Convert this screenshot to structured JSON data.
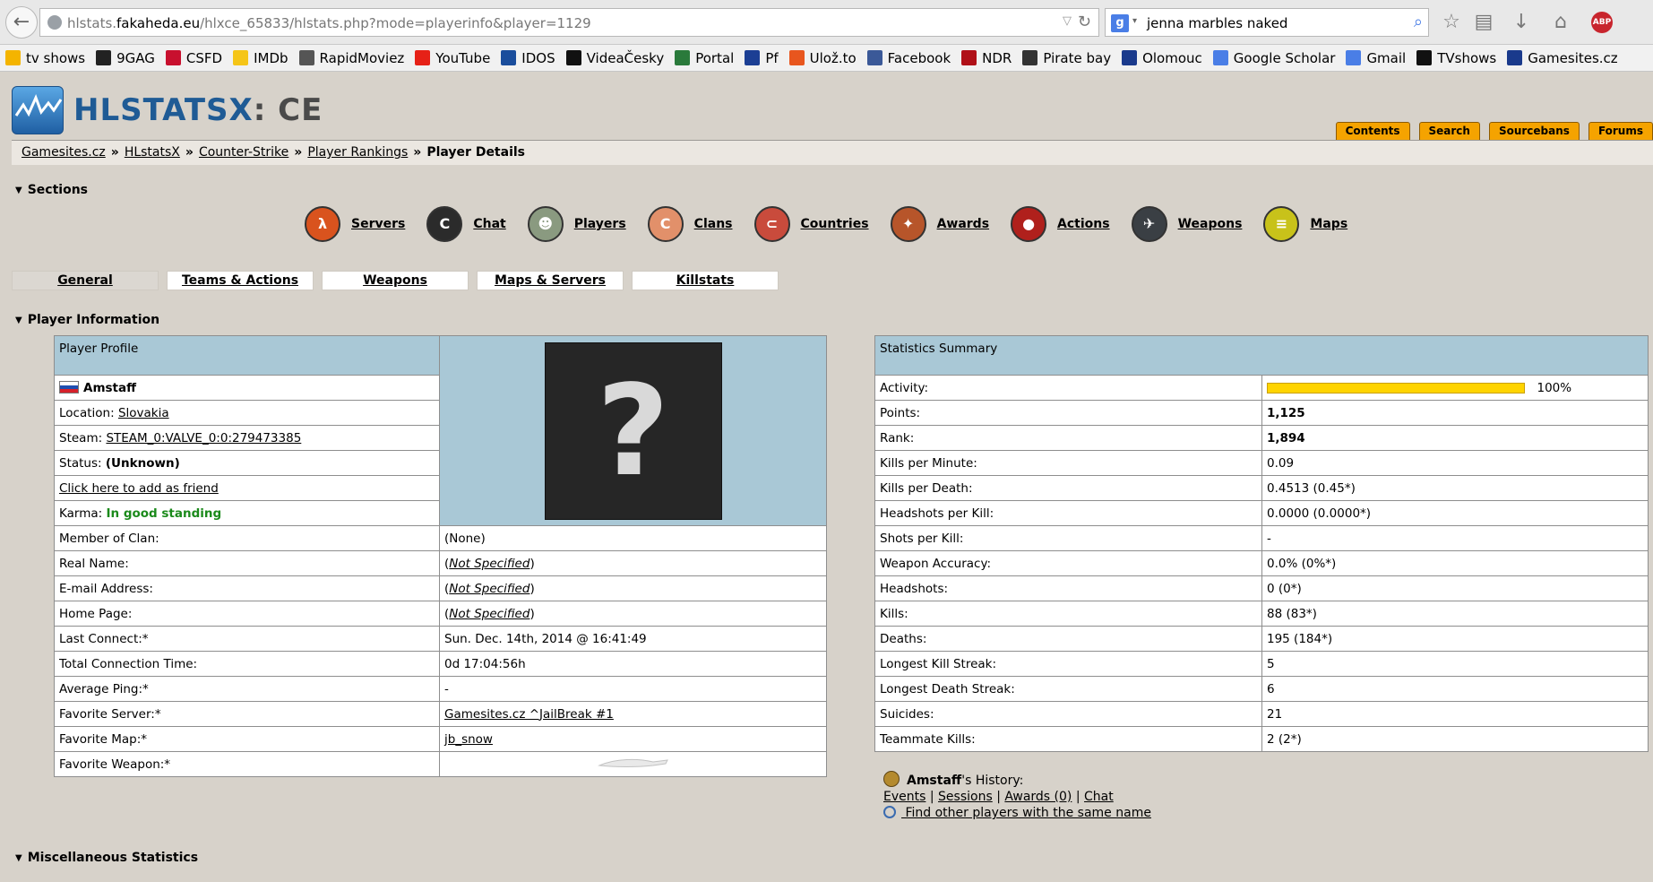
{
  "browser": {
    "url_prefix": "hlstats.",
    "url_domain": "fakaheda.eu",
    "url_path": "/hlxce_65833/hlstats.php?mode=playerinfo&player=1129",
    "search_query": "jenna marbles naked",
    "abp_label": "ABP",
    "bookmarks": [
      {
        "label": "tv shows",
        "color": "#f4b400"
      },
      {
        "label": "9GAG",
        "color": "#222222"
      },
      {
        "label": "CSFD",
        "color": "#c8102e"
      },
      {
        "label": "IMDb",
        "color": "#f5c518"
      },
      {
        "label": "RapidMoviez",
        "color": "#555555"
      },
      {
        "label": "YouTube",
        "color": "#e62117"
      },
      {
        "label": "IDOS",
        "color": "#1a4d9c"
      },
      {
        "label": "VideaČesky",
        "color": "#111111"
      },
      {
        "label": "Portal",
        "color": "#2a7a3b"
      },
      {
        "label": "Pf",
        "color": "#1c3f94"
      },
      {
        "label": "Ulož.to",
        "color": "#e8561e"
      },
      {
        "label": "Facebook",
        "color": "#3b5998"
      },
      {
        "label": "NDR",
        "color": "#b01018"
      },
      {
        "label": "Pirate bay",
        "color": "#333333"
      },
      {
        "label": "Olomouc",
        "color": "#1a3a8c"
      },
      {
        "label": "Google Scholar",
        "color": "#4a7ee6"
      },
      {
        "label": "Gmail",
        "color": "#4a7ee6"
      },
      {
        "label": "TVshows",
        "color": "#111111"
      },
      {
        "label": "Gamesites.cz",
        "color": "#1a3a8c"
      }
    ]
  },
  "logo": {
    "main": "HLSTATSX",
    "suffix": ": CE"
  },
  "top_nav": [
    "Contents",
    "Search",
    "Sourcebans",
    "Forums"
  ],
  "breadcrumb": {
    "items": [
      "Gamesites.cz",
      "HLstatsX",
      "Counter-Strike",
      "Player Rankings"
    ],
    "current": "Player Details"
  },
  "sections": {
    "title": "Sections",
    "items": [
      {
        "label": "Servers",
        "glyph": "λ",
        "color": "#d9531e",
        "icon": "halflife-icon"
      },
      {
        "label": "Chat",
        "glyph": "C",
        "color": "#2b2b2b",
        "icon": "chat-icon"
      },
      {
        "label": "Players",
        "glyph": "☻",
        "color": "#8a9a80",
        "icon": "players-icon"
      },
      {
        "label": "Clans",
        "glyph": "C",
        "color": "#e2906a",
        "icon": "clans-icon"
      },
      {
        "label": "Countries",
        "glyph": "⊂",
        "color": "#c94b3c",
        "icon": "countries-icon"
      },
      {
        "label": "Awards",
        "glyph": "✦",
        "color": "#b7552a",
        "icon": "awards-icon"
      },
      {
        "label": "Actions",
        "glyph": "●",
        "color": "#b0201c",
        "icon": "actions-icon"
      },
      {
        "label": "Weapons",
        "glyph": "✈",
        "color": "#3a3f44",
        "icon": "weapons-icon"
      },
      {
        "label": "Maps",
        "glyph": "≡",
        "color": "#c8c21a",
        "icon": "maps-icon"
      }
    ]
  },
  "tabs": [
    "General",
    "Teams & Actions",
    "Weapons",
    "Maps & Servers",
    "Killstats"
  ],
  "player_info_title": "Player Information",
  "profile": {
    "header": "Player Profile",
    "name": "Amstaff",
    "location_label": "Location:",
    "location_value": "Slovakia",
    "steam_label": "Steam:",
    "steam_value": "STEAM_0:VALVE_0:0:279473385",
    "status_label": "Status:",
    "status_value": "(Unknown)",
    "add_friend": "Click here to add as friend",
    "karma_label": "Karma:",
    "karma_value": "In good standing",
    "avatar_glyph": "?",
    "rows": [
      {
        "label": "Member of Clan:",
        "value": "(None)"
      },
      {
        "label": "Real Name:",
        "value": "Not Specified"
      },
      {
        "label": "E-mail Address:",
        "value": "Not Specified"
      },
      {
        "label": "Home Page:",
        "value": "Not Specified"
      },
      {
        "label": "Last Connect:*",
        "value": "Sun. Dec. 14th, 2014 @ 16:41:49"
      },
      {
        "label": "Total Connection Time:",
        "value": "0d 17:04:56h"
      },
      {
        "label": "Average Ping:*",
        "value": "-"
      },
      {
        "label": "Favorite Server:*",
        "value": "Gamesites.cz ^JailBreak #1"
      },
      {
        "label": "Favorite Map:*",
        "value": "jb_snow"
      },
      {
        "label": "Favorite Weapon:*",
        "value": ""
      }
    ]
  },
  "stats": {
    "header": "Statistics Summary",
    "activity_label": "Activity:",
    "activity_value": "100%",
    "activity_fraction": 1.0,
    "rows": [
      {
        "label": "Points:",
        "value": "1,125"
      },
      {
        "label": "Rank:",
        "value": "1,894"
      },
      {
        "label": "Kills per Minute:",
        "value": "0.09"
      },
      {
        "label": "Kills per Death:",
        "value": "0.4513 (0.45*)"
      },
      {
        "label": "Headshots per Kill:",
        "value": "0.0000 (0.0000*)"
      },
      {
        "label": "Shots per Kill:",
        "value": "-"
      },
      {
        "label": "Weapon Accuracy:",
        "value": "0.0% (0%*)"
      },
      {
        "label": "Headshots:",
        "value": "0 (0*)"
      },
      {
        "label": "Kills:",
        "value": "88 (83*)"
      },
      {
        "label": "Deaths:",
        "value": "195 (184*)"
      },
      {
        "label": "Longest Kill Streak:",
        "value": "5"
      },
      {
        "label": "Longest Death Streak:",
        "value": "6"
      },
      {
        "label": "Suicides:",
        "value": "21"
      },
      {
        "label": "Teammate Kills:",
        "value": "2 (2*)"
      }
    ]
  },
  "history": {
    "name": "Amstaff",
    "suffix": "'s History:",
    "links": [
      "Events",
      "Sessions",
      "Awards (0)",
      "Chat"
    ],
    "find_other": " Find other players with the same name"
  },
  "misc_title": "Miscellaneous Statistics"
}
